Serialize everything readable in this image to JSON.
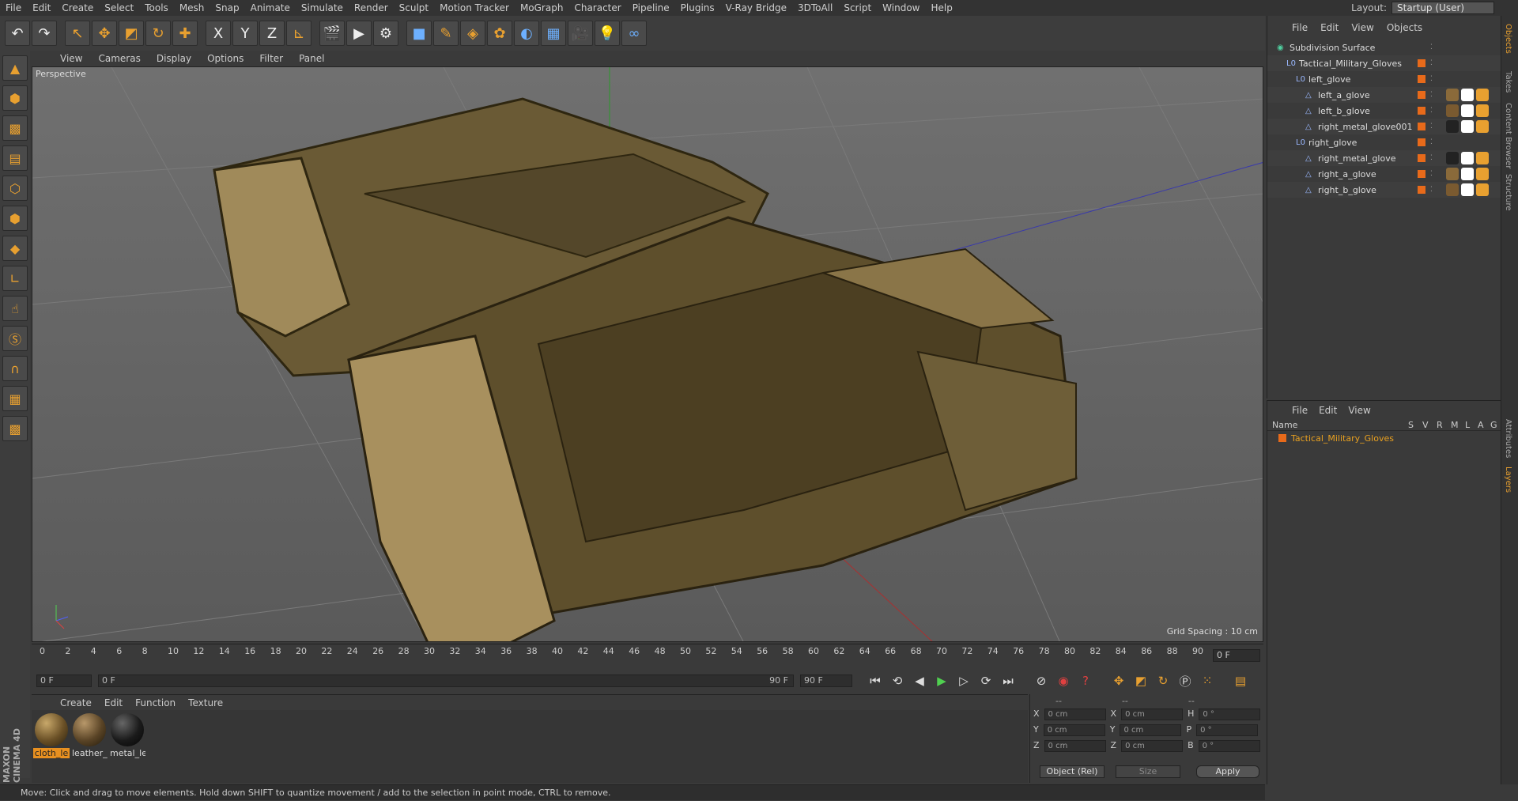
{
  "menu": [
    "File",
    "Edit",
    "Create",
    "Select",
    "Tools",
    "Mesh",
    "Snap",
    "Animate",
    "Simulate",
    "Render",
    "Sculpt",
    "Motion Tracker",
    "MoGraph",
    "Character",
    "Pipeline",
    "Plugins",
    "V-Ray Bridge",
    "3DToAll",
    "Script",
    "Window",
    "Help"
  ],
  "layout": {
    "label": "Layout:",
    "value": "Startup (User)"
  },
  "toolbar": {
    "x": "X",
    "y": "Y",
    "z": "Z"
  },
  "viewport": {
    "menu": [
      "View",
      "Cameras",
      "Display",
      "Options",
      "Filter",
      "Panel"
    ],
    "label": "Perspective",
    "grid_spacing": "Grid Spacing : 10 cm"
  },
  "timeline": {
    "ticks": [
      "0",
      "2",
      "4",
      "6",
      "8",
      "10",
      "12",
      "14",
      "16",
      "18",
      "20",
      "22",
      "24",
      "26",
      "28",
      "30",
      "32",
      "34",
      "36",
      "38",
      "40",
      "42",
      "44",
      "46",
      "48",
      "50",
      "52",
      "54",
      "56",
      "58",
      "60",
      "62",
      "64",
      "66",
      "68",
      "70",
      "72",
      "74",
      "76",
      "78",
      "80",
      "82",
      "84",
      "86",
      "88",
      "90"
    ],
    "current_frame": "0 F"
  },
  "transport": {
    "start": "0 F",
    "range_start": "0 F",
    "range_end": "90 F",
    "end": "90 F"
  },
  "materials": {
    "menu": [
      "Create",
      "Edit",
      "Function",
      "Texture"
    ],
    "items": [
      {
        "label": "cloth_le",
        "selected": true
      },
      {
        "label": "leather_",
        "selected": false
      },
      {
        "label": "metal_le",
        "selected": false
      }
    ]
  },
  "coords": {
    "headers": [
      "--",
      "--",
      "--"
    ],
    "rows": [
      {
        "a": "X",
        "av": "0 cm",
        "b": "X",
        "bv": "0 cm",
        "c": "H",
        "cv": "0 °"
      },
      {
        "a": "Y",
        "av": "0 cm",
        "b": "Y",
        "bv": "0 cm",
        "c": "P",
        "cv": "0 °"
      },
      {
        "a": "Z",
        "av": "0 cm",
        "b": "Z",
        "bv": "0 cm",
        "c": "B",
        "cv": "0 °"
      }
    ],
    "mode": "Object (Rel)",
    "size": "Size",
    "apply": "Apply"
  },
  "status": "Move: Click and drag to move elements. Hold down SHIFT to quantize movement / add to the selection in point mode, CTRL to remove.",
  "objects": {
    "menu": [
      "File",
      "Edit",
      "View",
      "Objects"
    ],
    "tree": [
      {
        "name": "Subdivision Surface",
        "indent": 0
      },
      {
        "name": "Tactical_Military_Gloves",
        "indent": 1
      },
      {
        "name": "left_glove",
        "indent": 2
      },
      {
        "name": "left_a_glove",
        "indent": 3
      },
      {
        "name": "left_b_glove",
        "indent": 3
      },
      {
        "name": "right_metal_glove001",
        "indent": 3
      },
      {
        "name": "right_glove",
        "indent": 2
      },
      {
        "name": "right_metal_glove",
        "indent": 3
      },
      {
        "name": "right_a_glove",
        "indent": 3
      },
      {
        "name": "right_b_glove",
        "indent": 3
      }
    ]
  },
  "layers": {
    "menu": [
      "File",
      "Edit",
      "View"
    ],
    "columns": {
      "name": "Name",
      "s": "S",
      "v": "V",
      "r": "R",
      "m": "M",
      "l": "L",
      "a": "A",
      "g": "G"
    },
    "row": "Tactical_Military_Gloves"
  },
  "side_tabs": [
    "Objects",
    "Takes",
    "Content Browser",
    "Structure",
    "Attributes",
    "Layers"
  ],
  "logo": "MAXON CINEMA 4D",
  "colors": {
    "accent": "#e8a030",
    "tag": "#e86a1a",
    "selected_text": "#e8a020"
  }
}
